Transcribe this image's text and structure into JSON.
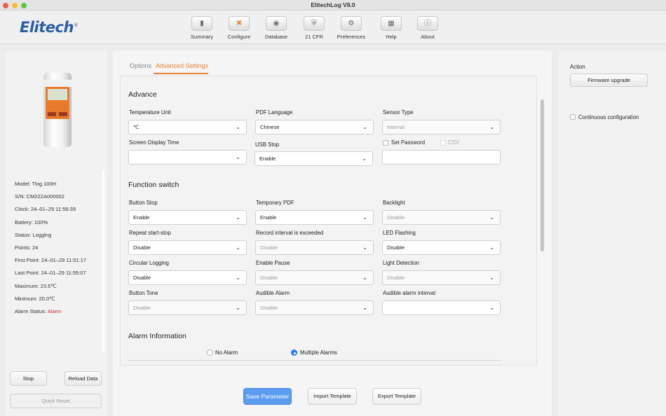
{
  "window": {
    "title": "ElitechLog V8.0"
  },
  "logo": {
    "text": "Elitech",
    "mark": "®"
  },
  "toolbar": [
    {
      "label": "Summary",
      "icon": "summary-icon"
    },
    {
      "label": "Configure",
      "icon": "tools-icon"
    },
    {
      "label": "Database",
      "icon": "database-icon"
    },
    {
      "label": "21 CFR",
      "icon": "shield-icon"
    },
    {
      "label": "Preferences",
      "icon": "gear-icon"
    },
    {
      "label": "Help",
      "icon": "book-icon"
    },
    {
      "label": "About",
      "icon": "info-icon"
    }
  ],
  "device": {
    "info": [
      "Model: Tlog 100H",
      "S/N: CM222A000002",
      "Clock: 24–01–29 11:56:39",
      "Battery: 100%",
      "Status: Logging",
      "Points: 24",
      "First Point: 24–01–29 11:51:17",
      "Last Point: 24–01–29 11:55:07",
      "Maximum: 23.5℃",
      "Minimum: 20.0℃"
    ],
    "alarm_label": "Alarm Status: ",
    "alarm_value": "Alarm",
    "alarm_color": "#d62c2c"
  },
  "left_buttons": {
    "stop": "Stop",
    "reload": "Reload Data",
    "quick_reset": "Quick Reset"
  },
  "tabs": {
    "options": "Options",
    "advanced": "Advanced Settings",
    "accent": "#e8833a"
  },
  "advance": {
    "heading": "Advance",
    "temperature_unit": {
      "label": "Temperature Unit",
      "value": "℃"
    },
    "pdf_language": {
      "label": "PDF Language",
      "value": "Chinese"
    },
    "sensor_type": {
      "label": "Sensor Type",
      "value": "Internal"
    },
    "screen_display_time": {
      "label": "Screen Display Time",
      "value": ""
    },
    "usb_stop": {
      "label": "USB Stop",
      "value": "Enable"
    },
    "set_password": {
      "label": "Set Password",
      "checked": false
    },
    "csv": {
      "label": "CSV",
      "checked": false
    }
  },
  "function_switch": {
    "heading": "Function switch",
    "button_stop": {
      "label": "Button Stop",
      "value": "Enable"
    },
    "temporary_pdf": {
      "label": "Temporary PDF",
      "value": "Enable"
    },
    "backlight": {
      "label": "Backlight",
      "value": "Disable"
    },
    "repeat_start_stop": {
      "label": "Repeat start-stop",
      "value": "Disable"
    },
    "record_interval_exceeded": {
      "label": "Record interval is exceeded",
      "value": "Disable"
    },
    "led_flashing": {
      "label": "LED Flashing",
      "value": "Disable"
    },
    "circular_logging": {
      "label": "Circular Logging",
      "value": "Disable"
    },
    "enable_pause": {
      "label": "Enable Pause",
      "value": "Disable"
    },
    "light_detection": {
      "label": "Light Detection",
      "value": "Disable"
    },
    "button_tone": {
      "label": "Button Tone",
      "value": "Disable"
    },
    "audible_alarm": {
      "label": "Audible Alarm",
      "value": "Disable"
    },
    "audible_alarm_interval": {
      "label": "Audible alarm interval",
      "value": ""
    }
  },
  "alarm_information": {
    "heading": "Alarm Information",
    "no_alarm": {
      "label": "No Alarm",
      "selected": false
    },
    "multiple_alarms": {
      "label": "Multiple Alarms",
      "selected": true
    }
  },
  "bottom_buttons": {
    "save": "Save Parameter",
    "import": "Import Template",
    "export": "Export Template"
  },
  "action": {
    "heading": "Action",
    "firmware": "Firmware upgrade",
    "continuous": "Continuous configuration",
    "continuous_checked": false
  }
}
